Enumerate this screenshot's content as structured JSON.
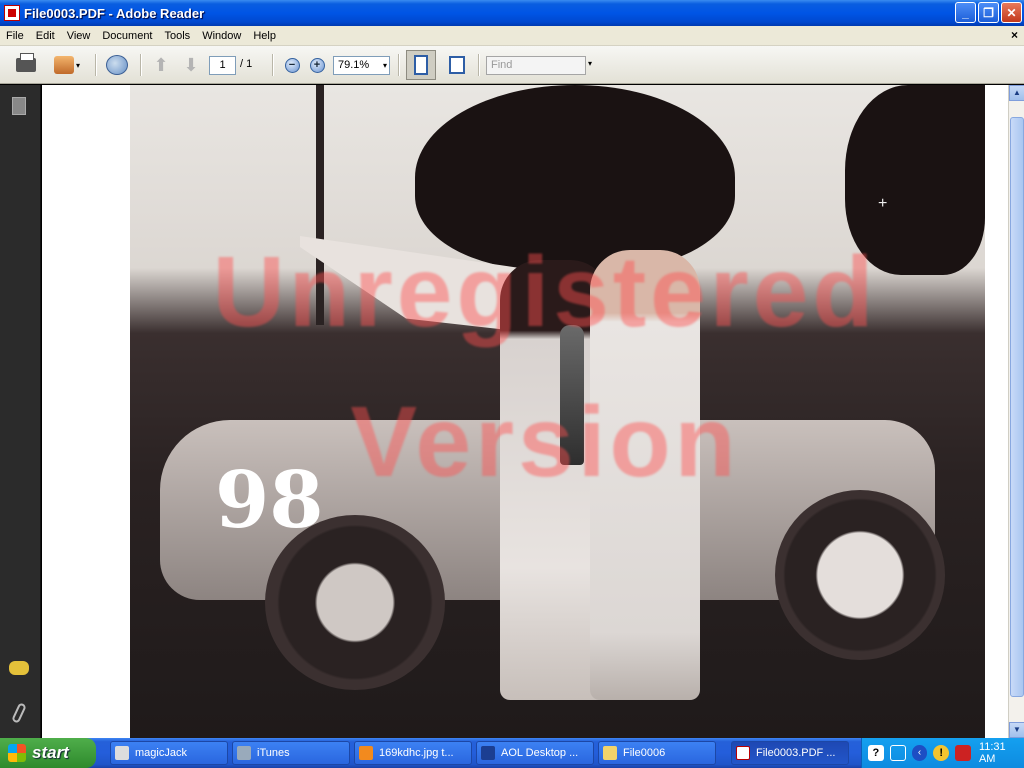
{
  "window": {
    "title": "File0003.PDF - Adobe Reader",
    "buttons": {
      "minimize": "_",
      "restore": "❐",
      "close": "✕"
    }
  },
  "menu": {
    "items": [
      "File",
      "Edit",
      "View",
      "Document",
      "Tools",
      "Window",
      "Help"
    ],
    "doc_close": "×"
  },
  "toolbar": {
    "current_page": "1",
    "page_total": "/ 1",
    "zoom": "79.1%",
    "zoom_out_label": "−",
    "zoom_in_label": "+",
    "find_placeholder": "Find",
    "dropdown_glyph": "▾",
    "prev_glyph": "⬆",
    "next_glyph": "⬇"
  },
  "document": {
    "watermark_line1": "Unregistered",
    "watermark_line2": "Version",
    "car_number": "98",
    "crosshair": "+"
  },
  "scrollbar": {
    "up": "▲",
    "down": "▼"
  },
  "taskbar": {
    "start_label": "start",
    "tasks": [
      {
        "label": "magicJack",
        "icon": "magicjack-icon"
      },
      {
        "label": "iTunes",
        "icon": "itunes-icon"
      },
      {
        "label": "169kdhc.jpg t...",
        "icon": "firefox-icon"
      },
      {
        "label": "AOL Desktop ...",
        "icon": "aol-icon"
      },
      {
        "label": "File0006",
        "icon": "folder-icon"
      },
      {
        "label": "File0003.PDF ...",
        "icon": "pdf-icon"
      }
    ],
    "tray": {
      "help": "?",
      "arrow": "‹",
      "warn": "!",
      "clock": "11:31 AM"
    }
  },
  "colors": {
    "titlebar": "#0055e5",
    "taskbar": "#245edb",
    "start": "#2e8a2c",
    "tray": "#0e8be0",
    "watermark": "#ff5050"
  }
}
